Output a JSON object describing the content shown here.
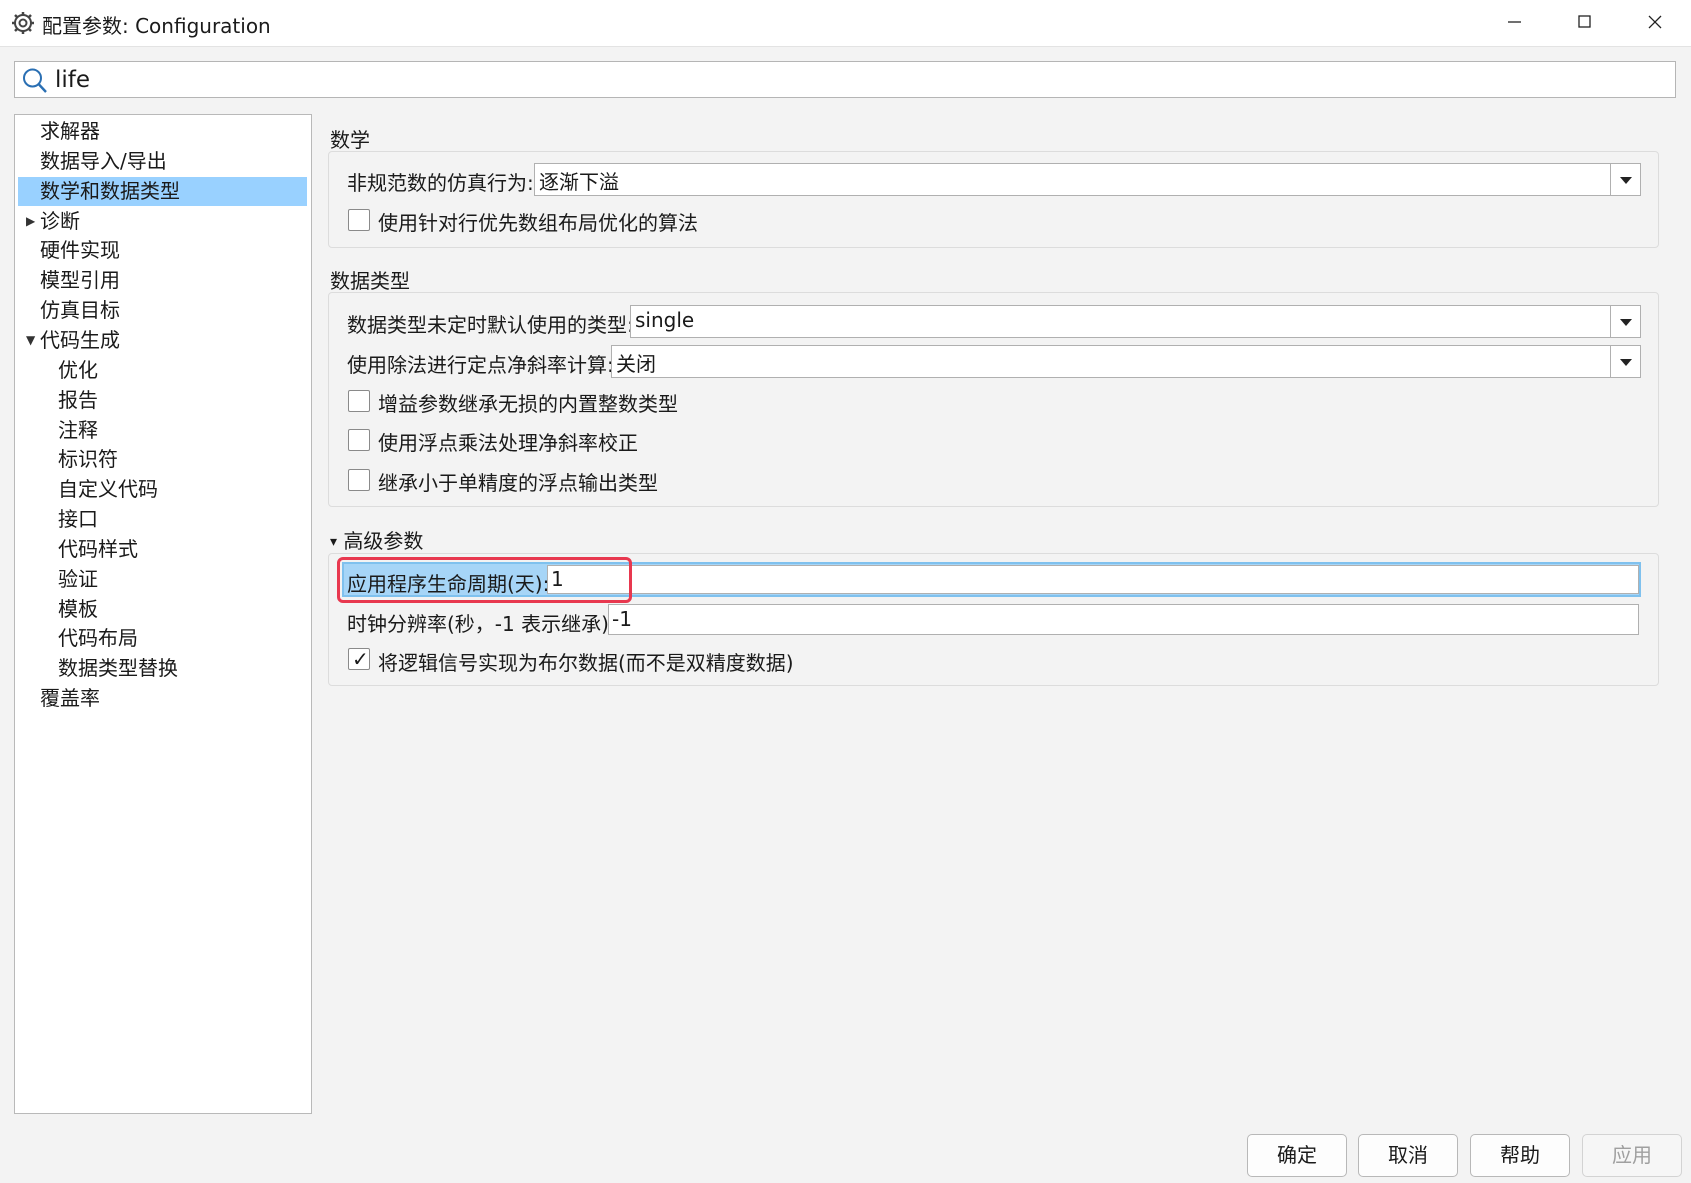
{
  "window": {
    "title": "配置参数: Configuration",
    "icon": "gear-settings-icon"
  },
  "search": {
    "value": "life"
  },
  "tree": {
    "items": [
      {
        "label": "求解器",
        "level": 0,
        "expander": "none",
        "selected": false
      },
      {
        "label": "数据导入/导出",
        "level": 0,
        "expander": "none",
        "selected": false
      },
      {
        "label": "数学和数据类型",
        "level": 0,
        "expander": "none",
        "selected": true
      },
      {
        "label": "诊断",
        "level": 0,
        "expander": "collapsed",
        "selected": false
      },
      {
        "label": "硬件实现",
        "level": 0,
        "expander": "none",
        "selected": false
      },
      {
        "label": "模型引用",
        "level": 0,
        "expander": "none",
        "selected": false
      },
      {
        "label": "仿真目标",
        "level": 0,
        "expander": "none",
        "selected": false
      },
      {
        "label": "代码生成",
        "level": 0,
        "expander": "expanded",
        "selected": false
      },
      {
        "label": "优化",
        "level": 1,
        "expander": "none",
        "selected": false
      },
      {
        "label": "报告",
        "level": 1,
        "expander": "none",
        "selected": false
      },
      {
        "label": "注释",
        "level": 1,
        "expander": "none",
        "selected": false
      },
      {
        "label": "标识符",
        "level": 1,
        "expander": "none",
        "selected": false
      },
      {
        "label": "自定义代码",
        "level": 1,
        "expander": "none",
        "selected": false
      },
      {
        "label": "接口",
        "level": 1,
        "expander": "none",
        "selected": false
      },
      {
        "label": "代码样式",
        "level": 1,
        "expander": "none",
        "selected": false
      },
      {
        "label": "验证",
        "level": 1,
        "expander": "none",
        "selected": false
      },
      {
        "label": "模板",
        "level": 1,
        "expander": "none",
        "selected": false
      },
      {
        "label": "代码布局",
        "level": 1,
        "expander": "none",
        "selected": false
      },
      {
        "label": "数据类型替换",
        "level": 1,
        "expander": "none",
        "selected": false
      },
      {
        "label": "覆盖率",
        "level": 0,
        "expander": "none",
        "selected": false
      }
    ]
  },
  "math": {
    "title": "数学",
    "denormal_label": "非规范数的仿真行为:",
    "denormal_value": "逐渐下溢",
    "row_major_label": "使用针对行优先数组布局优化的算法",
    "row_major_checked": false
  },
  "datatypes": {
    "title": "数据类型",
    "default_type_label": "数据类型未定时默认使用的类型:",
    "default_type_value": "single",
    "division_label": "使用除法进行定点净斜率计算:",
    "division_value": "关闭",
    "gain_label": "增益参数继承无损的内置整数类型",
    "gain_checked": false,
    "float_mult_label": "使用浮点乘法处理净斜率校正",
    "float_mult_checked": false,
    "inherit_float_label": "继承小于单精度的浮点输出类型",
    "inherit_float_checked": false
  },
  "advanced": {
    "title": "高级参数",
    "expander": "▾",
    "lifespan_label": "应用程序生命周期(天):",
    "lifespan_value": "1",
    "clock_label": "时钟分辨率(秒，-1 表示继承):",
    "clock_value": "-1",
    "boolean_label": "将逻辑信号实现为布尔数据(而不是双精度数据)",
    "boolean_checked": true
  },
  "footer": {
    "ok": "确定",
    "cancel": "取消",
    "help": "帮助",
    "apply": "应用",
    "apply_enabled": false
  },
  "colors": {
    "selection": "#99d1ff",
    "highlight_row": "#a6d5f7",
    "highlight_border": "#e8384f"
  }
}
